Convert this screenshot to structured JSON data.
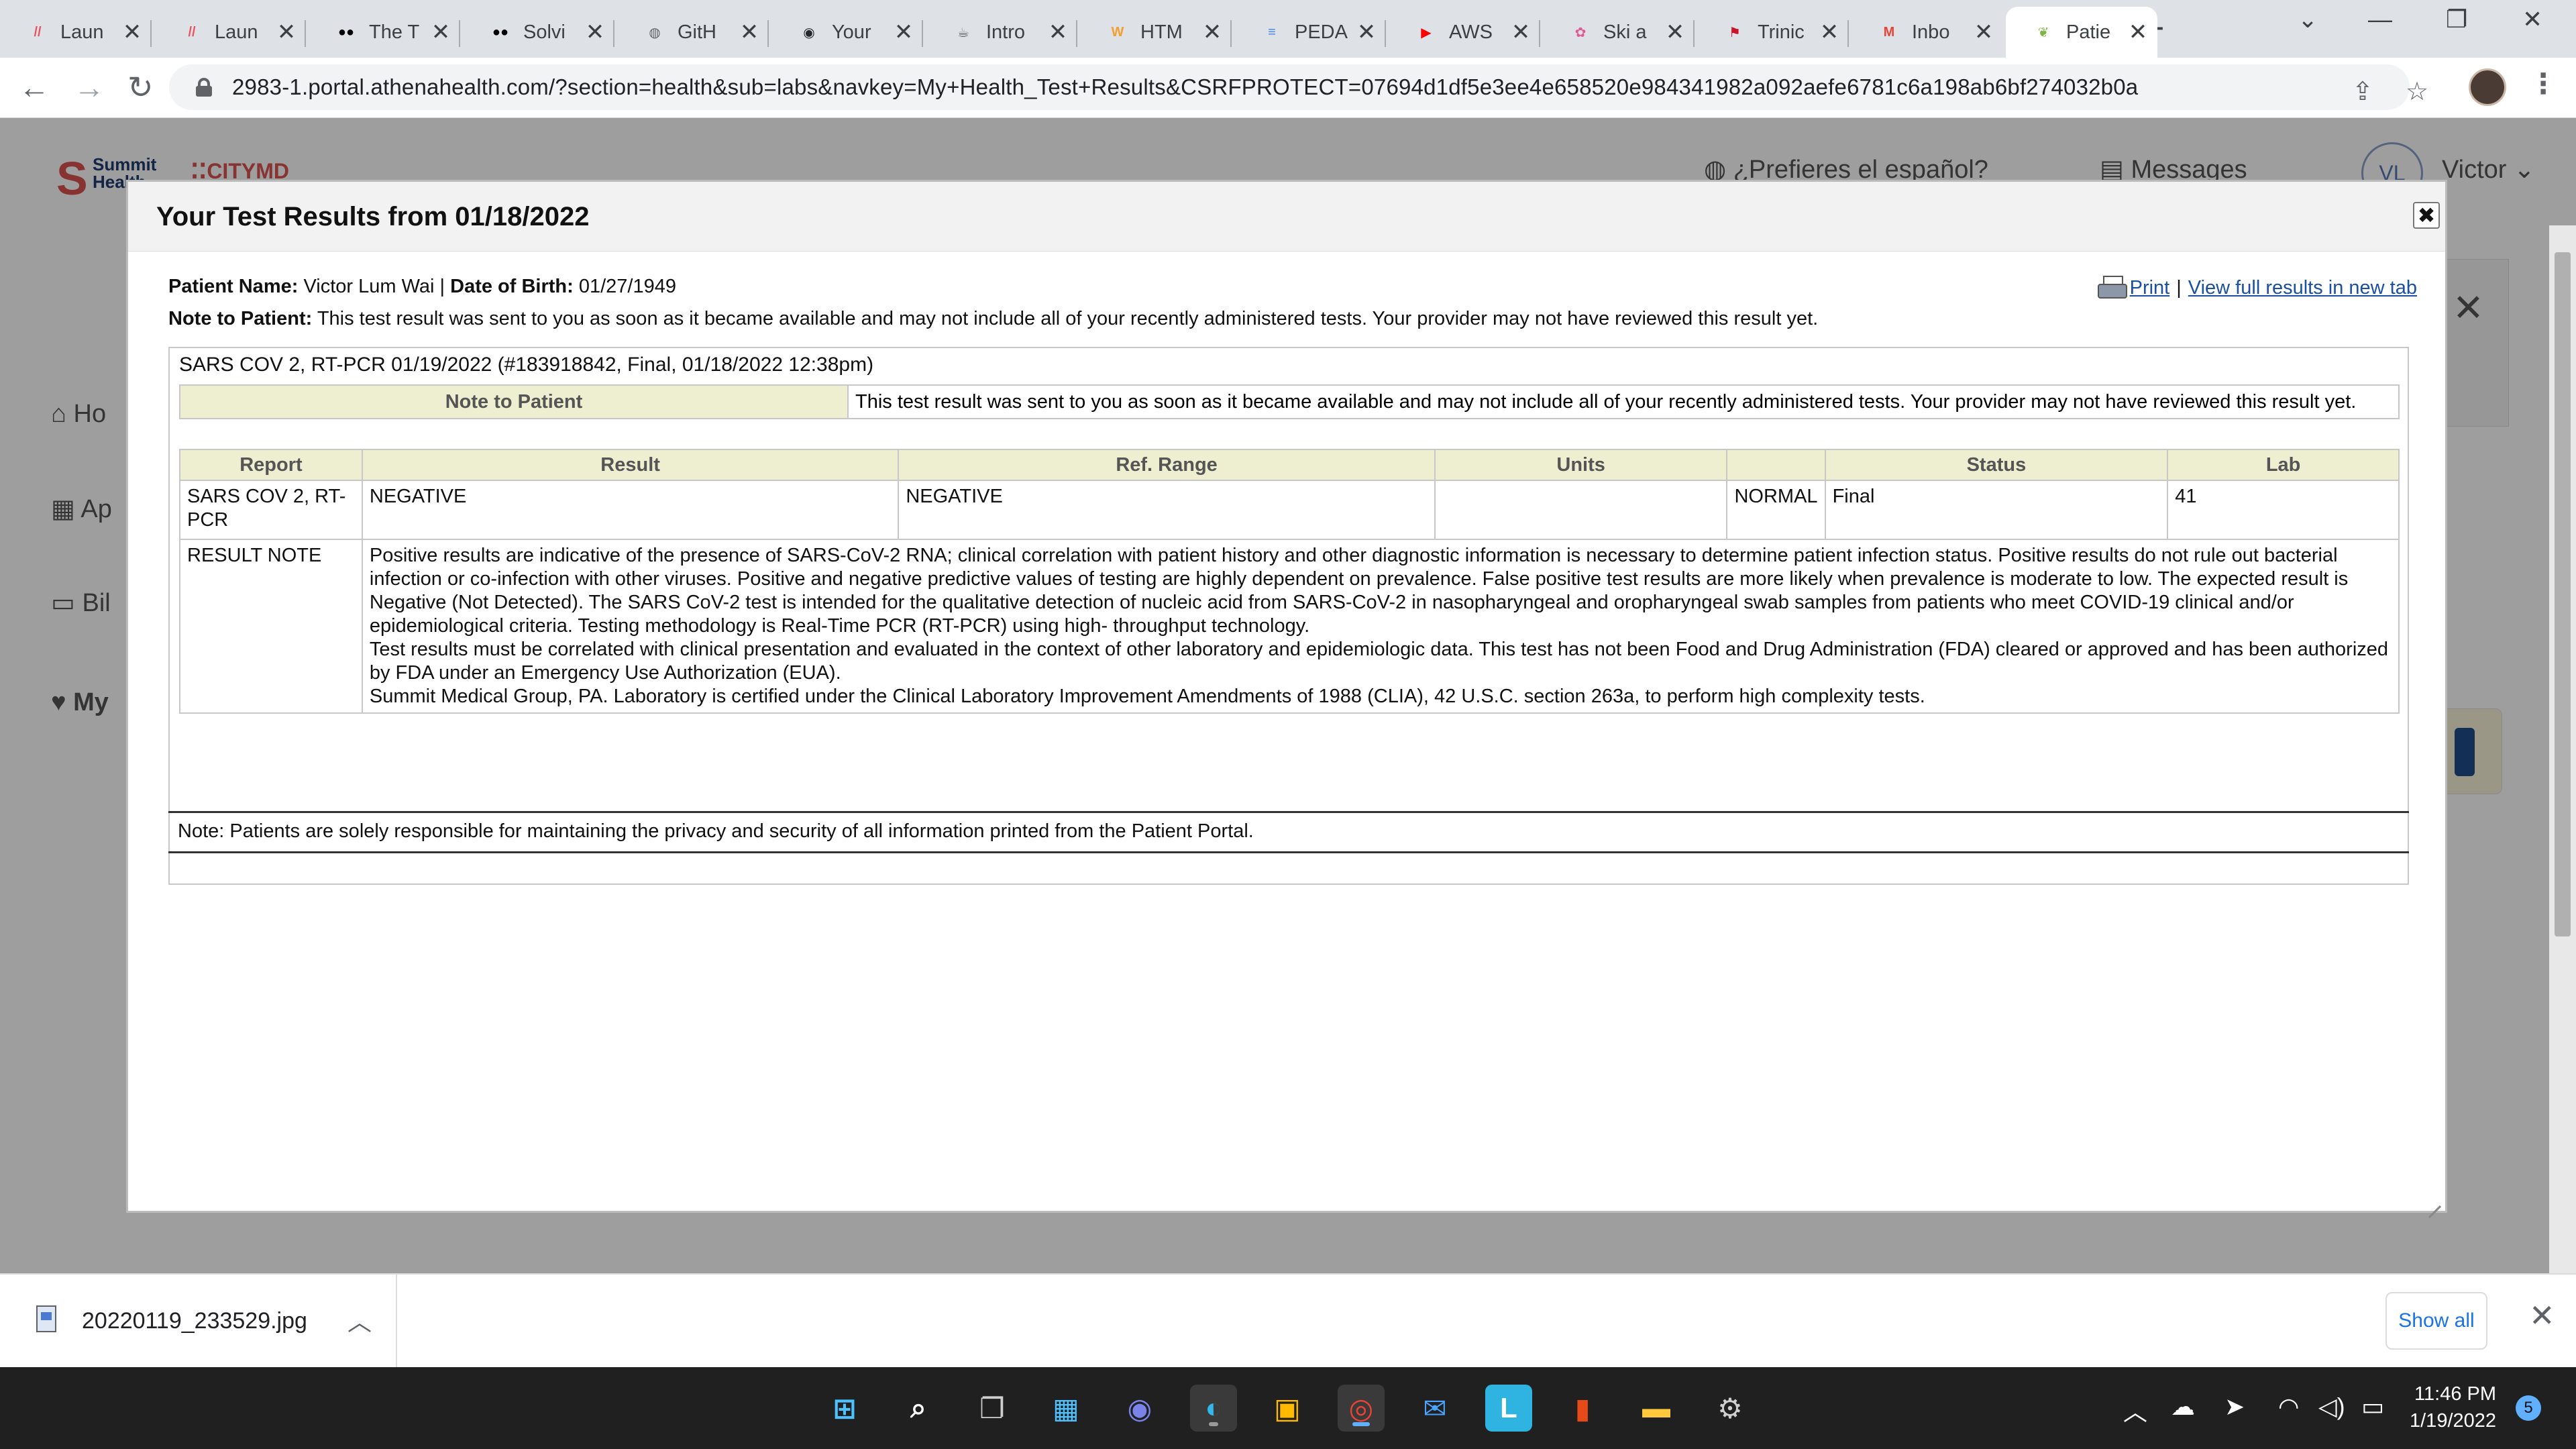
{
  "browser": {
    "tabs": [
      {
        "title": "Laun",
        "favicon": "launchdarkly-icon",
        "color": "#e8545f",
        "glyph": "//"
      },
      {
        "title": "Laun",
        "favicon": "launchdarkly-icon",
        "color": "#e8545f",
        "glyph": "//"
      },
      {
        "title": "The T",
        "favicon": "medium-icon",
        "color": "#000000",
        "glyph": "●●"
      },
      {
        "title": "Solvi",
        "favicon": "medium-icon",
        "color": "#000000",
        "glyph": "●●"
      },
      {
        "title": "GitH",
        "favicon": "globe-icon",
        "color": "#5f6368",
        "glyph": "◍"
      },
      {
        "title": "Your",
        "favicon": "github-icon",
        "color": "#24292f",
        "glyph": "◉"
      },
      {
        "title": "Intro",
        "favicon": "stackshare-icon",
        "color": "#5f6368",
        "glyph": "☕"
      },
      {
        "title": "HTM",
        "favicon": "w3-icon",
        "color": "#f0a030",
        "glyph": "W"
      },
      {
        "title": "PEDA",
        "favicon": "google-docs-icon",
        "color": "#4285f4",
        "glyph": "≡"
      },
      {
        "title": "AWS",
        "favicon": "youtube-icon",
        "color": "#ff0000",
        "glyph": "▶"
      },
      {
        "title": "Ski a",
        "favicon": "ski-icon",
        "color": "#e05a9a",
        "glyph": "✿"
      },
      {
        "title": "Trinic",
        "favicon": "flag-icon",
        "color": "#ce1126",
        "glyph": "⚑"
      },
      {
        "title": "Inbo",
        "favicon": "gmail-icon",
        "color": "#ea4335",
        "glyph": "M"
      },
      {
        "title": "Patie",
        "favicon": "athena-icon",
        "color": "#7cb342",
        "glyph": "❦",
        "active": true
      }
    ],
    "url": "2983-1.portal.athenahealth.com/?section=health&sub=labs&navkey=My+Health_Test+Results&CSRFPROTECT=07694d1df5e3ee4e658520e984341982a092aefe6781c6a198ab6bf274032b0a"
  },
  "portal": {
    "brand_name_line1": "Summit",
    "brand_name_line2": "Health",
    "brand_city": "CITYMD",
    "language_link": "¿Prefieres el español?",
    "messages_link": "Messages",
    "avatar_initials": "VL",
    "user_name": "Victor",
    "sidebar": [
      "Ho",
      "Ap",
      "Bil",
      "My"
    ]
  },
  "modal": {
    "title": "Your Test Results from 01/18/2022",
    "patient_name_label": "Patient Name:",
    "patient_name": "Victor Lum Wai",
    "separator": "|",
    "dob_label": "Date of Birth:",
    "dob": "01/27/1949",
    "note_label": "Note to Patient:",
    "note": "This test result was sent to you as soon as it became available and may not include all of your recently administered tests. Your provider may not have reviewed this result yet.",
    "print_label": "Print",
    "view_full_label": "View full results in new tab",
    "result_heading": "SARS COV 2, RT-PCR 01/19/2022 (#183918842, Final, 01/18/2022 12:38pm)",
    "note_to_patient_header": "Note to Patient",
    "note_to_patient_text": "This test result was sent to you as soon as it became available and may not include all of your recently administered tests. Your provider may not have reviewed this result yet.",
    "columns": [
      "Report",
      "Result",
      "Ref. Range",
      "Units",
      "",
      "Status",
      "Lab"
    ],
    "rows": [
      {
        "report": "SARS COV 2, RT-PCR",
        "result": "NEGATIVE",
        "ref_range": "NEGATIVE",
        "units": "",
        "flag": "NORMAL",
        "status": "Final",
        "lab": "41"
      }
    ],
    "result_note_label": "RESULT NOTE",
    "result_note_lines": [
      "Positive results are indicative of the presence of SARS-CoV-2 RNA; clinical correlation with patient history and other diagnostic information is necessary to determine patient infection status. Positive results do not rule out bacterial infection or co-infection with other viruses. Positive and negative predictive values of testing are highly dependent on prevalence. False positive test results are more likely when prevalence is moderate to low. The expected result is Negative (Not Detected). The SARS CoV-2 test is intended for the qualitative detection of nucleic acid from SARS-CoV-2 in nasopharyngeal and oropharyngeal swab samples from patients who meet COVID-19 clinical and/or epidemiological criteria. Testing methodology is Real-Time PCR (RT-PCR) using high- throughput technology.",
      "Test results must be correlated with clinical presentation and evaluated in the context of other laboratory and epidemiologic data. This test has not been Food and Drug Administration (FDA) cleared or approved and has been authorized by FDA under an Emergency Use Authorization (EUA).",
      "Summit Medical Group, PA. Laboratory is certified under the Clinical Laboratory Improvement Amendments of 1988 (CLIA), 42 U.S.C. section 263a, to perform high complexity tests."
    ],
    "footer_note": "Note: Patients are solely responsible for maintaining the privacy and security of all information printed from the Patient Portal."
  },
  "download": {
    "file": "20220119_233529.jpg",
    "show_all": "Show all"
  },
  "taskbar": {
    "time": "11:46 PM",
    "date": "1/19/2022",
    "notifications": "5"
  },
  "colors": {
    "table_header_bg": "#eeeed0",
    "link": "#1a4fa3",
    "accent_red": "#d9534f"
  }
}
